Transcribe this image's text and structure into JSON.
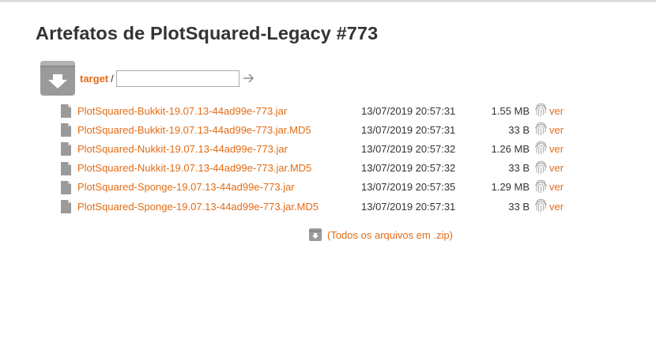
{
  "page": {
    "title": "Artefatos de PlotSquared-Legacy #773"
  },
  "nav": {
    "archive_icon": "download-archive-icon",
    "crumb_label": "target",
    "crumb_separator": "/",
    "path_value": "",
    "go_icon": "arrow-right-icon"
  },
  "files": [
    {
      "name": "PlotSquared-Bukkit-19.07.13-44ad99e-773.jar",
      "date": "13/07/2019 20:57:31",
      "size": "1.55 MB",
      "view": "ver"
    },
    {
      "name": "PlotSquared-Bukkit-19.07.13-44ad99e-773.jar.MD5",
      "date": "13/07/2019 20:57:31",
      "size": "33 B",
      "view": "ver"
    },
    {
      "name": "PlotSquared-Nukkit-19.07.13-44ad99e-773.jar",
      "date": "13/07/2019 20:57:32",
      "size": "1.26 MB",
      "view": "ver"
    },
    {
      "name": "PlotSquared-Nukkit-19.07.13-44ad99e-773.jar.MD5",
      "date": "13/07/2019 20:57:32",
      "size": "33 B",
      "view": "ver"
    },
    {
      "name": "PlotSquared-Sponge-19.07.13-44ad99e-773.jar",
      "date": "13/07/2019 20:57:35",
      "size": "1.29 MB",
      "view": "ver"
    },
    {
      "name": "PlotSquared-Sponge-19.07.13-44ad99e-773.jar.MD5",
      "date": "13/07/2019 20:57:31",
      "size": "33 B",
      "view": "ver"
    }
  ],
  "icons": {
    "file": "file-icon",
    "fingerprint": "fingerprint-icon",
    "zip": "download-archive-icon"
  },
  "zip": {
    "label": "(Todos os arquivos em .zip)"
  },
  "colors": {
    "link": "#e36c16",
    "text": "#333333",
    "icon_gray": "#9a9a9a"
  }
}
